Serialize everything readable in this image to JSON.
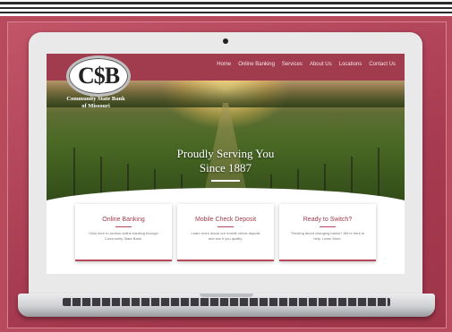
{
  "nav": {
    "items": [
      "Home",
      "Online Banking",
      "Services",
      "About Us",
      "Locations",
      "Contact Us"
    ]
  },
  "logo": {
    "mark": "C$B",
    "name_line1": "Community State Bank",
    "name_line2": "of Missouri"
  },
  "hero": {
    "line1": "Proudly Serving You",
    "line2": "Since 1887"
  },
  "cards": [
    {
      "title": "Online Banking",
      "body": "Click here to access online banking through Community State Bank."
    },
    {
      "title": "Mobile Check Deposit",
      "body": "Learn more about our mobile check deposit and see if you qualify."
    },
    {
      "title": "Ready to Switch?",
      "body": "Thinking about changing banks? We're here to help. Learn More."
    }
  ],
  "colors": {
    "brand": "#a13b4e",
    "background": "#b84a5e"
  }
}
